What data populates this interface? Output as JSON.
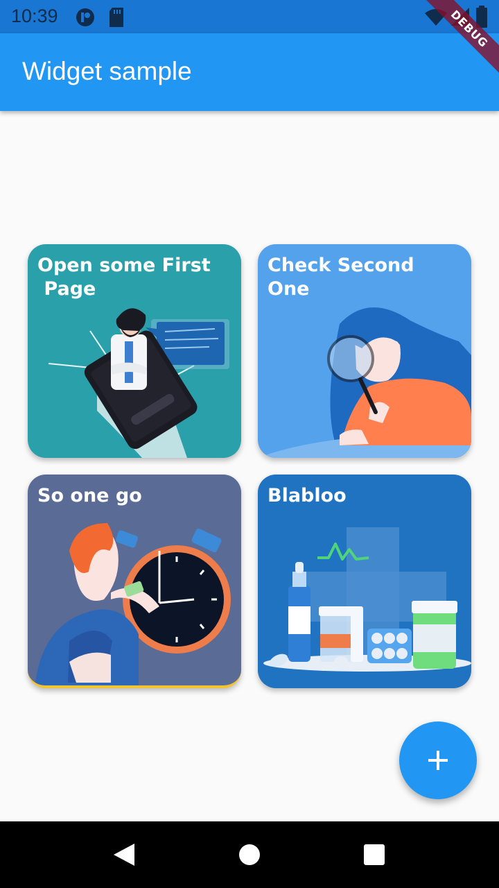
{
  "status_bar": {
    "time": "10:39",
    "icons": [
      "app-notification-icon",
      "sd-card-icon",
      "wifi-icon",
      "signal-icon",
      "battery-icon"
    ]
  },
  "debug_banner": {
    "label": "DEBUG"
  },
  "app_bar": {
    "title": "Widget sample",
    "color": "#2196f3"
  },
  "cards": [
    {
      "title": "Open some First\n Page",
      "bg": "#2aa0ab",
      "illustration": "doctor-phone-illustration"
    },
    {
      "title": "Check Second One",
      "bg": "#54a2ec",
      "illustration": "magnifier-woman-illustration"
    },
    {
      "title": "So one go",
      "bg": "#5a6b96",
      "illustration": "clock-drink-illustration"
    },
    {
      "title": "Blabloo",
      "bg": "#1f73c0",
      "illustration": "medicine-illustration"
    }
  ],
  "fab": {
    "icon": "plus-icon",
    "color": "#2196f3"
  },
  "nav_bar": {
    "icons": [
      "back-icon",
      "home-icon",
      "recents-icon"
    ]
  }
}
